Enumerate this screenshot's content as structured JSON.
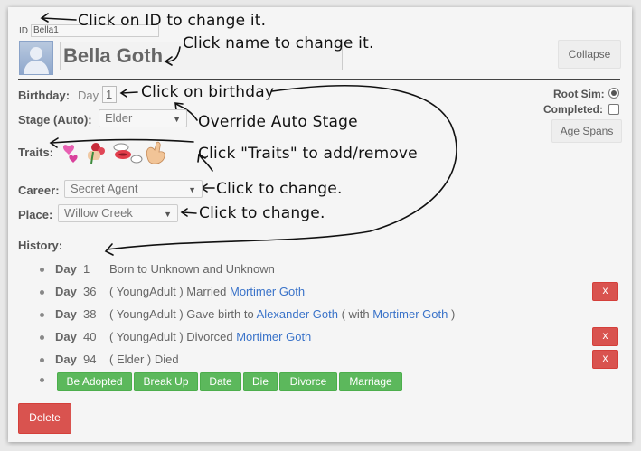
{
  "header": {
    "id_label": "ID",
    "id_value": "Bella1",
    "name_value": "Bella Goth",
    "collapse_label": "Collapse"
  },
  "annotations": {
    "id": "Click on ID to change it.",
    "name": "Click name to change it.",
    "birthday": "Click on birthday",
    "stage": "Override Auto Stage",
    "traits": "Click \"Traits\" to add/remove",
    "career": "Click to change.",
    "place": "Click to change."
  },
  "fields": {
    "birthday_label": "Birthday:",
    "birthday_prefix": "Day",
    "birthday_value": "1",
    "stage_label": "Stage",
    "stage_auto": "(Auto):",
    "stage_value": "Elder",
    "traits_label": "Traits:",
    "career_label": "Career:",
    "career_value": "Secret Agent",
    "place_label": "Place:",
    "place_value": "Willow Creek"
  },
  "side": {
    "root_sim_label": "Root Sim:",
    "completed_label": "Completed:",
    "age_spans_label": "Age Spans"
  },
  "traits_icons": [
    "hearts-icon",
    "roses-icon",
    "kiss-icon",
    "hand-icon"
  ],
  "history": {
    "label": "History:",
    "day_word": "Day",
    "rows": [
      {
        "day": "1",
        "pre": "Born to Unknown and Unknown",
        "link1": "",
        "mid": "",
        "link2": "",
        "post": "",
        "delete": false
      },
      {
        "day": "36",
        "pre": "( YoungAdult ) Married",
        "link1": "Mortimer Goth",
        "mid": "",
        "link2": "",
        "post": "",
        "delete": true
      },
      {
        "day": "38",
        "pre": "( YoungAdult ) Gave birth to",
        "link1": "Alexander Goth",
        "mid": "( with",
        "link2": "Mortimer Goth",
        "post": ")",
        "delete": false
      },
      {
        "day": "40",
        "pre": "( YoungAdult ) Divorced",
        "link1": "Mortimer Goth",
        "mid": "",
        "link2": "",
        "post": "",
        "delete": true
      },
      {
        "day": "94",
        "pre": "( Elder ) Died",
        "link1": "",
        "mid": "",
        "link2": "",
        "post": "",
        "delete": true
      }
    ],
    "delete_label": "x"
  },
  "actions": [
    "Be Adopted",
    "Break Up",
    "Date",
    "Die",
    "Divorce",
    "Marriage"
  ],
  "delete_button": "Delete",
  "colors": {
    "green": "#5cb85c",
    "red": "#d9534f",
    "link": "#3a73c9"
  }
}
